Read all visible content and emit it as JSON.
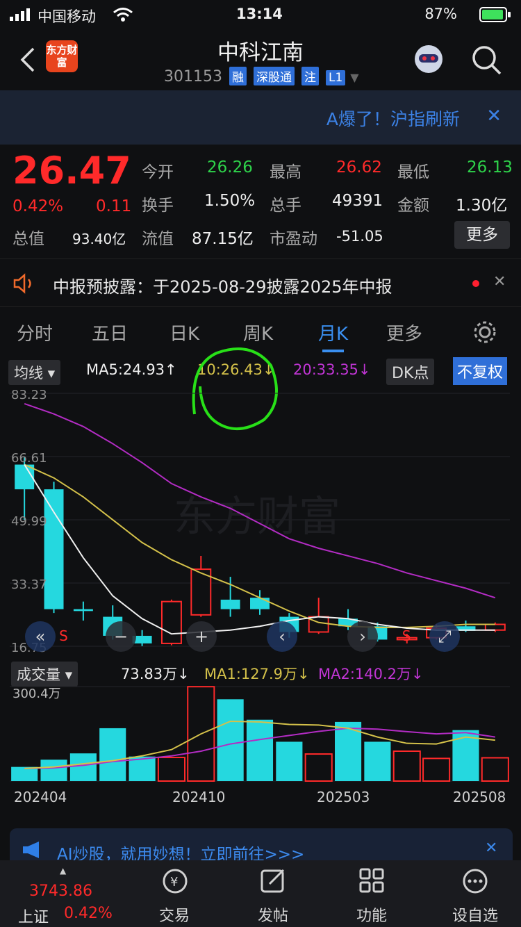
{
  "status": {
    "carrier": "中国移动",
    "time": "13:14",
    "battery": "87%"
  },
  "header": {
    "logo": "东方财富",
    "title": "中科江南",
    "code": "301153",
    "tags": [
      "融",
      "深股通",
      "注",
      "L1"
    ]
  },
  "banner": {
    "text": "A爆了！沪指刷新"
  },
  "quote": {
    "price": "26.47",
    "change_pct": "0.42%",
    "change": "0.11",
    "open_label": "今开",
    "open": "26.26",
    "high_label": "最高",
    "high": "26.62",
    "low_label": "最低",
    "low": "26.13",
    "turnover_label": "换手",
    "turnover": "1.50%",
    "volume_label": "总手",
    "volume": "49391",
    "amount_label": "金额",
    "amount": "1.30亿",
    "mktcap_label": "总值",
    "mktcap": "93.40亿",
    "float_label": "流值",
    "float": "87.15亿",
    "pe_label": "市盈动",
    "pe": "-51.05",
    "more": "更多"
  },
  "notice": {
    "text": "中报预披露：于2025-08-29披露2025年中报"
  },
  "tabs": [
    "分时",
    "五日",
    "日K",
    "周K",
    "月K",
    "更多"
  ],
  "ma_row": {
    "selector": "均线",
    "ma5": "MA5:24.93↑",
    "ma10": "10:26.43↓",
    "ma20": "20:33.35↓",
    "dk": "DK点",
    "adjust": "不复权"
  },
  "vol_row": {
    "selector": "成交量",
    "vol": "73.83万↓",
    "ma1": "MA1:127.9万↓",
    "ma2": "MA2:140.2万↓"
  },
  "watermark": "东方财富",
  "colors": {
    "up": "#ff2a2a",
    "down": "#25d8df",
    "ma5": "#f0f0f0",
    "ma10": "#d4c14a",
    "ma20": "#b32cc4",
    "accent": "#3a8ff0"
  },
  "chart_data": [
    {
      "type": "candlestick",
      "title": "",
      "y_ticks": [
        "83.23",
        "66.61",
        "49.99",
        "33.37",
        "16.75"
      ],
      "ylim": [
        16.75,
        83.23
      ],
      "candles": [
        {
          "o": 64.5,
          "c": 58.0,
          "h": 66.6,
          "l": 50.0
        },
        {
          "o": 58.0,
          "c": 26.5,
          "h": 60.0,
          "l": 25.5
        },
        {
          "o": 26.5,
          "c": 26.0,
          "h": 28.5,
          "l": 23.5
        },
        {
          "o": 24.5,
          "c": 19.5,
          "h": 27.5,
          "l": 18.5
        },
        {
          "o": 19.5,
          "c": 17.5,
          "h": 21.0,
          "l": 16.8
        },
        {
          "o": 17.5,
          "c": 28.5,
          "h": 29.0,
          "l": 17.0
        },
        {
          "o": 25.0,
          "c": 37.0,
          "h": 40.5,
          "l": 24.5
        },
        {
          "o": 29.0,
          "c": 26.5,
          "h": 35.0,
          "l": 24.5
        },
        {
          "o": 29.5,
          "c": 26.5,
          "h": 31.5,
          "l": 25.0
        },
        {
          "o": 24.5,
          "c": 20.5,
          "h": 25.5,
          "l": 19.0
        },
        {
          "o": 20.5,
          "c": 24.5,
          "h": 29.5,
          "l": 20.0
        },
        {
          "o": 24.0,
          "c": 22.0,
          "h": 26.5,
          "l": 21.0
        },
        {
          "o": 22.0,
          "c": 18.5,
          "h": 23.0,
          "l": 18.0
        },
        {
          "o": 18.5,
          "c": 19.0,
          "h": 20.0,
          "l": 17.5
        },
        {
          "o": 19.0,
          "c": 21.5,
          "h": 22.5,
          "l": 18.5
        },
        {
          "o": 22.0,
          "c": 20.8,
          "h": 23.5,
          "l": 20.5
        },
        {
          "o": 21.0,
          "c": 22.5,
          "h": 23.0,
          "l": 20.5
        }
      ],
      "ma5": [
        64.5,
        52,
        40,
        30,
        24,
        20,
        20.5,
        21,
        22,
        23.5,
        24.5,
        24,
        22.5,
        21.5,
        21,
        21,
        21
      ],
      "ma10": [
        64.5,
        61,
        56,
        50,
        44,
        39.5,
        36,
        33,
        29.5,
        26,
        23,
        22,
        21.7,
        21.7,
        22,
        22.5,
        22.5
      ],
      "ma20": [
        80.5,
        77.8,
        74.5,
        70,
        65,
        59.5,
        56,
        53,
        49,
        45,
        42.5,
        40.5,
        38.5,
        36,
        34,
        32,
        29.5
      ],
      "markers": [
        "S",
        "S"
      ]
    },
    {
      "type": "bar",
      "title": "",
      "y_ticks": [
        "300.4万"
      ],
      "ylim": [
        0,
        300.4
      ],
      "x_ticks": [
        "202404",
        "202410",
        "202503",
        "202508"
      ],
      "values": [
        45,
        68,
        88,
        168,
        78,
        75,
        300,
        260,
        195,
        125,
        86,
        188,
        125,
        95,
        72,
        162,
        74
      ],
      "ma1": [
        40,
        45,
        55,
        65,
        80,
        100,
        150,
        190,
        188,
        180,
        178,
        168,
        140,
        120,
        118,
        140,
        130
      ],
      "ma2": [
        40,
        42,
        50,
        62,
        70,
        80,
        95,
        118,
        132,
        145,
        158,
        168,
        165,
        157,
        150,
        154,
        140
      ]
    }
  ]
}
